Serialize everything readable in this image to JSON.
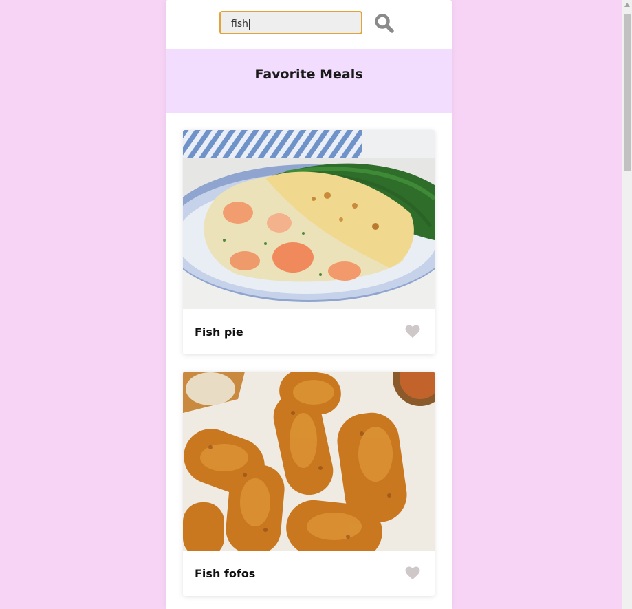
{
  "search": {
    "value": "fish",
    "button_icon": "magnifier-icon"
  },
  "favorites": {
    "title": "Favorite Meals"
  },
  "meals": [
    {
      "name": "Fish pie",
      "image": "fish-pie-photo",
      "favorite_icon": "heart-icon",
      "favorited": false
    },
    {
      "name": "Fish fofos",
      "image": "fish-fofos-photo",
      "favorite_icon": "heart-icon",
      "favorited": false
    }
  ],
  "colors": {
    "page_background": "#f7d3f6",
    "favorites_background": "#f3ddff",
    "input_border": "#e2a438",
    "heart_inactive": "#cfc8c8",
    "search_icon": "#8a8a8a"
  }
}
